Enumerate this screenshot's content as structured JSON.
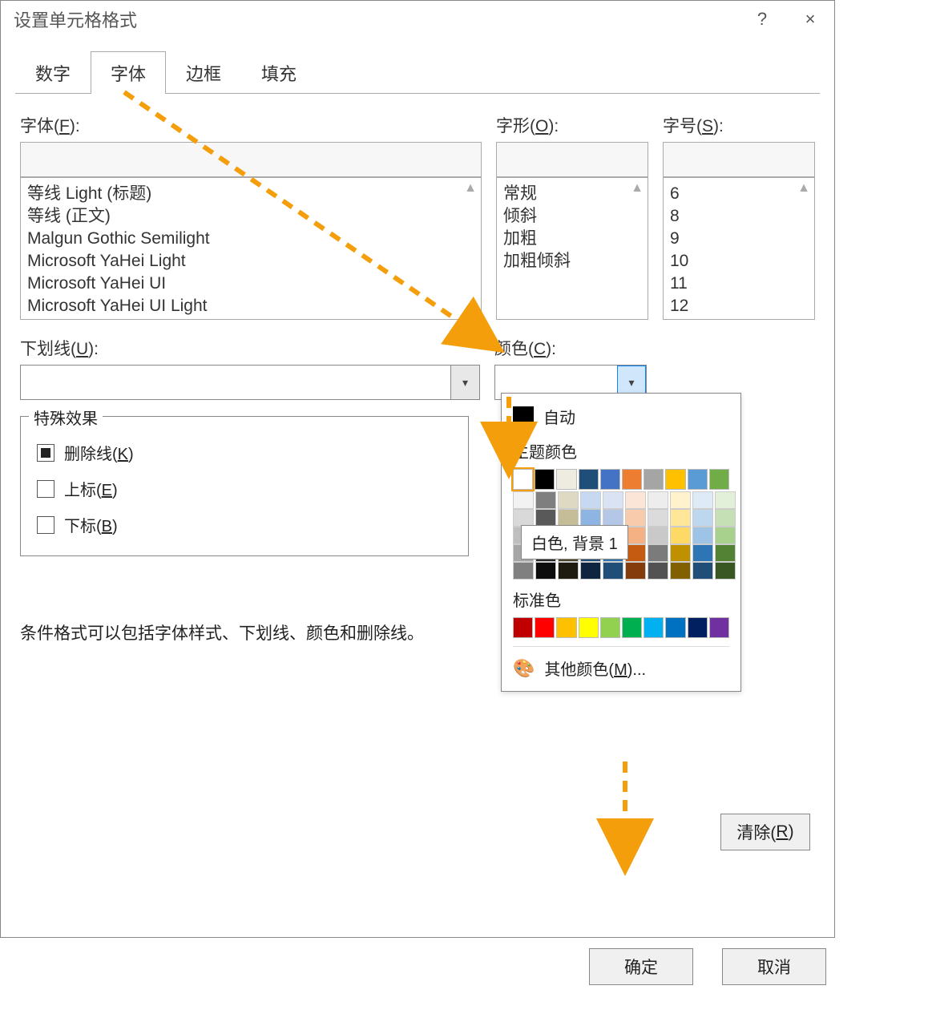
{
  "dialog": {
    "title": "设置单元格格式",
    "help_icon": "?",
    "close_icon": "×"
  },
  "tabs": [
    "数字",
    "字体",
    "边框",
    "填充"
  ],
  "active_tab_index": 1,
  "font_tab": {
    "font_label": "字体(F):",
    "style_label": "字形(O):",
    "size_label": "字号(S):",
    "font_list": [
      "等线 Light (标题)",
      "等线 (正文)",
      "Malgun Gothic Semilight",
      "Microsoft YaHei Light",
      "Microsoft YaHei UI",
      "Microsoft YaHei UI Light"
    ],
    "style_list": [
      "常规",
      "倾斜",
      "加粗",
      "加粗倾斜"
    ],
    "size_list": [
      "6",
      "8",
      "9",
      "10",
      "11",
      "12"
    ],
    "underline_label": "下划线(U):",
    "color_label": "颜色(C):",
    "effects_legend": "特殊效果",
    "effects": {
      "strikethrough": "删除线(K)",
      "superscript": "上标(E)",
      "subscript": "下标(B)"
    },
    "footnote": "条件格式可以包括字体样式、下划线、颜色和删除线。",
    "clear_button": "清除(R)",
    "ok_button": "确定",
    "cancel_button": "取消"
  },
  "color_picker": {
    "auto_label": "自动",
    "theme_label": "主题颜色",
    "standard_label": "标准色",
    "more_label": "其他颜色(M)...",
    "tooltip": "白色, 背景 1",
    "theme_row1": [
      "#ffffff",
      "#000000",
      "#eeece1",
      "#1f4e79",
      "#4472c4",
      "#ed7d31",
      "#a5a5a5",
      "#ffc000",
      "#5b9bd5",
      "#70ad47"
    ],
    "theme_shades": [
      [
        "#f2f2f2",
        "#7f7f7f",
        "#ddd9c3",
        "#c6d9f1",
        "#dae3f3",
        "#fbe5d6",
        "#ededed",
        "#fff2cc",
        "#deebf7",
        "#e2f0d9"
      ],
      [
        "#d9d9d9",
        "#595959",
        "#c4bd97",
        "#8eb4e3",
        "#b4c7e7",
        "#f8cbad",
        "#dbdbdb",
        "#ffe699",
        "#bdd7ee",
        "#c5e0b4"
      ],
      [
        "#bfbfbf",
        "#404040",
        "#948a54",
        "#558ed5",
        "#8faadc",
        "#f4b183",
        "#c9c9c9",
        "#ffd966",
        "#9dc3e6",
        "#a9d18e"
      ],
      [
        "#a6a6a6",
        "#262626",
        "#4a452a",
        "#1f4e79",
        "#2e75b6",
        "#c55a11",
        "#7b7b7b",
        "#bf9000",
        "#2e75b6",
        "#548235"
      ],
      [
        "#808080",
        "#0d0d0d",
        "#1e1c11",
        "#0f243e",
        "#1f4e79",
        "#843c0c",
        "#525252",
        "#806000",
        "#1f4e79",
        "#385723"
      ]
    ],
    "standard_row": [
      "#c00000",
      "#ff0000",
      "#ffc000",
      "#ffff00",
      "#92d050",
      "#00b050",
      "#00b0f0",
      "#0070c0",
      "#002060",
      "#7030a0"
    ]
  }
}
